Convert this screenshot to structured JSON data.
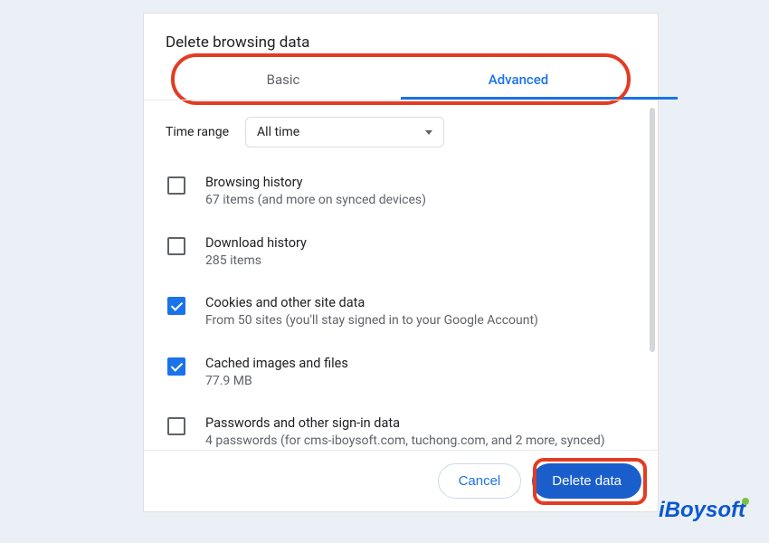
{
  "dialog": {
    "title": "Delete browsing data",
    "tabs": {
      "basic": "Basic",
      "advanced": "Advanced"
    },
    "time_range": {
      "label": "Time range",
      "value": "All time"
    },
    "items": [
      {
        "checked": false,
        "title": "Browsing history",
        "desc": "67 items (and more on synced devices)"
      },
      {
        "checked": false,
        "title": "Download history",
        "desc": "285 items"
      },
      {
        "checked": true,
        "title": "Cookies and other site data",
        "desc": "From 50 sites (you'll stay signed in to your Google Account)"
      },
      {
        "checked": true,
        "title": "Cached images and files",
        "desc": "77.9 MB"
      },
      {
        "checked": false,
        "title": "Passwords and other sign-in data",
        "desc": "4 passwords (for cms-iboysoft.com, tuchong.com, and 2 more, synced)"
      }
    ],
    "buttons": {
      "cancel": "Cancel",
      "delete": "Delete data"
    }
  },
  "watermark": "iBoysoft"
}
